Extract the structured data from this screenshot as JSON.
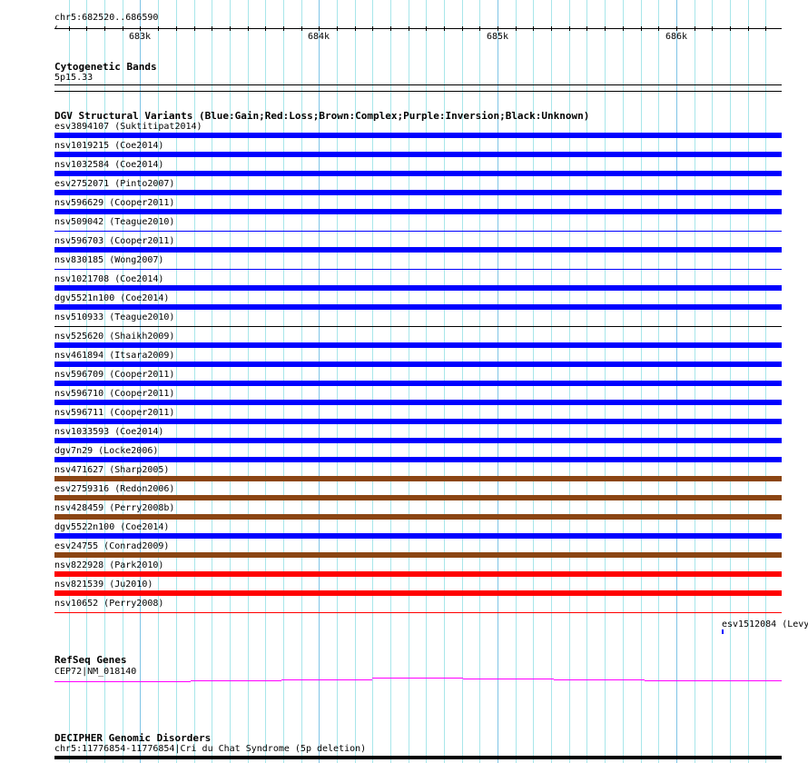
{
  "ruler": {
    "region": "chr5:682520..686590",
    "start": 682520,
    "end": 686590,
    "tick_labels": [
      "683k",
      "684k",
      "685k",
      "686k"
    ],
    "tick_values": [
      683000,
      684000,
      685000,
      686000
    ]
  },
  "cytoband": {
    "title": "Cytogenetic Bands",
    "band": "5p15.33"
  },
  "dgv": {
    "title": "DGV Structural Variants (Blue:Gain;Red:Loss;Brown:Complex;Purple:Inversion;Black:Unknown)",
    "colors": {
      "blue": "#0000ff",
      "red": "#ff0000",
      "brown": "#8b4513",
      "black": "#000000"
    },
    "rows": [
      {
        "label": "esv3894107 (Suktitipat2014)",
        "color": "blue",
        "style": "thick"
      },
      {
        "label": "nsv1019215 (Coe2014)",
        "color": "blue",
        "style": "thick"
      },
      {
        "label": "nsv1032584 (Coe2014)",
        "color": "blue",
        "style": "thick"
      },
      {
        "label": "esv2752071 (Pinto2007)",
        "color": "blue",
        "style": "thick"
      },
      {
        "label": "nsv596629 (Cooper2011)",
        "color": "blue",
        "style": "thick"
      },
      {
        "label": "nsv509042 (Teague2010)",
        "color": "blue",
        "style": "thin"
      },
      {
        "label": "nsv596703 (Cooper2011)",
        "color": "blue",
        "style": "thick"
      },
      {
        "label": "nsv830185 (Wong2007)",
        "color": "blue",
        "style": "thin"
      },
      {
        "label": "nsv1021708 (Coe2014)",
        "color": "blue",
        "style": "thick"
      },
      {
        "label": "dgv5521n100 (Coe2014)",
        "color": "blue",
        "style": "thick"
      },
      {
        "label": "nsv510933 (Teague2010)",
        "color": "black",
        "style": "thin"
      },
      {
        "label": "nsv525620 (Shaikh2009)",
        "color": "blue",
        "style": "thick"
      },
      {
        "label": "nsv461894 (Itsara2009)",
        "color": "blue",
        "style": "thick"
      },
      {
        "label": "nsv596709 (Cooper2011)",
        "color": "blue",
        "style": "thick"
      },
      {
        "label": "nsv596710 (Cooper2011)",
        "color": "blue",
        "style": "thick"
      },
      {
        "label": "nsv596711 (Cooper2011)",
        "color": "blue",
        "style": "thick"
      },
      {
        "label": "nsv1033593 (Coe2014)",
        "color": "blue",
        "style": "thick"
      },
      {
        "label": "dgv7n29 (Locke2006)",
        "color": "blue",
        "style": "thick"
      },
      {
        "label": "nsv471627 (Sharp2005)",
        "color": "brown",
        "style": "thick"
      },
      {
        "label": "esv2759316 (Redon2006)",
        "color": "brown",
        "style": "thick"
      },
      {
        "label": "nsv428459 (Perry2008b)",
        "color": "brown",
        "style": "thick"
      },
      {
        "label": "dgv5522n100 (Coe2014)",
        "color": "blue",
        "style": "thick"
      },
      {
        "label": "esv24755 (Conrad2009)",
        "color": "brown",
        "style": "thick"
      },
      {
        "label": "nsv822928 (Park2010)",
        "color": "red",
        "style": "thick"
      },
      {
        "label": "nsv821539 (Ju2010)",
        "color": "red",
        "style": "thick"
      },
      {
        "label": "nsv10652 (Perry2008)",
        "color": "red",
        "style": "thin"
      }
    ],
    "extra": {
      "label": "esv1512084 (Levy",
      "color": "blue"
    }
  },
  "refseq": {
    "title": "RefSeq Genes",
    "gene": "CEP72|NM_018140",
    "color": "#ff00ff"
  },
  "decipher": {
    "title": "DECIPHER Genomic Disorders",
    "label": "chr5:11776854-11776854|Cri du Chat Syndrome (5p deletion)"
  }
}
